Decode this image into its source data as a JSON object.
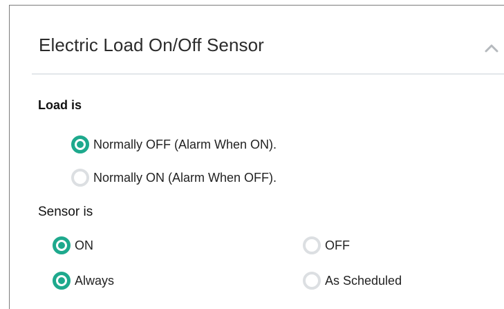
{
  "card": {
    "title": "Electric Load On/Off Sensor",
    "collapse_icon": "chevron-up-icon"
  },
  "load": {
    "label": "Load is",
    "options": [
      {
        "label": "Normally OFF (Alarm When ON).",
        "selected": true
      },
      {
        "label": "Normally ON (Alarm When OFF).",
        "selected": false
      }
    ]
  },
  "sensor": {
    "label": "Sensor is",
    "state_options": [
      {
        "label": "ON",
        "selected": true
      },
      {
        "label": "OFF",
        "selected": false
      }
    ],
    "schedule_options": [
      {
        "label": "Always",
        "selected": true
      },
      {
        "label": "As Scheduled",
        "selected": false
      }
    ]
  },
  "colors": {
    "accent": "#1ea98d",
    "radio_off": "#dcdfe2",
    "divider": "#e3e6ea"
  }
}
